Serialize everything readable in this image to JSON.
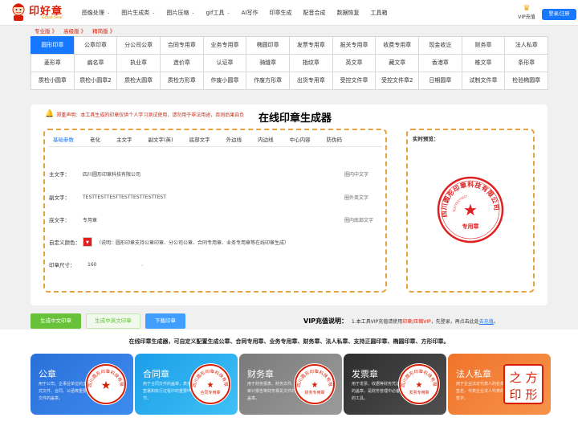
{
  "header": {
    "brand": "印好章",
    "brand_sub": "Good-Seal",
    "nav": [
      {
        "label": "图像处理",
        "dropdown": true
      },
      {
        "label": "图片生成类",
        "dropdown": true
      },
      {
        "label": "图片压缩",
        "dropdown": true
      },
      {
        "label": "gif工具",
        "dropdown": true
      },
      {
        "label": "AI写作",
        "dropdown": false
      },
      {
        "label": "印章生成",
        "dropdown": false
      },
      {
        "label": "配音合成",
        "dropdown": false
      },
      {
        "label": "数据恢复",
        "dropdown": false
      },
      {
        "label": "工具箱",
        "dropdown": false
      }
    ],
    "vip_label": "VIP充值",
    "login_label": "登录/注册"
  },
  "versions": [
    "专业版 》",
    "高级版 》",
    "精简版 》"
  ],
  "stamp_types": [
    [
      "圆形印章",
      "公章印章",
      "分公司公章",
      "合同专用章",
      "业务专用章",
      "椭圆印章",
      "发票专用章",
      "报关专用章",
      "收费专用章",
      "现金收讫",
      "财务章",
      "法人私章"
    ],
    [
      "菱形章",
      "扁名章",
      "执业章",
      "造价章",
      "认证章",
      "骑缝章",
      "指纹章",
      "英文章",
      "藏文章",
      "香港章",
      "椎文章",
      "条形章"
    ],
    [
      "质检小圆章",
      "质检小圆章2",
      "质检大圆章",
      "质检方形章",
      "作废小圆章",
      "作废方形章",
      "出货专用章",
      "受控文件章",
      "受控文件章2",
      "日期圆章",
      "试制文件章",
      "检验椭圆章"
    ]
  ],
  "active_stamp": "圆形印章",
  "notice": "郑重声明：本工具生成的印章仅供个人学习测试使用，请勿用于非法用途，否则后果自负",
  "page_title": "在线印章生成器",
  "tabs": [
    "基础参数",
    "老化",
    "主文字",
    "副文字(英)",
    "底部文字",
    "外边线",
    "内边线",
    "中心内容",
    "防伪码"
  ],
  "active_tab": "基础参数",
  "fields": {
    "main_text": {
      "label": "主文字：",
      "value": "四川圆形印章科技有限公司",
      "hint": "圈内中文字"
    },
    "sub_text": {
      "label": "副文字：",
      "value": "TESTTESTTESTTESTTESTTESTTEST",
      "hint": "圈外英文字"
    },
    "bottom_text": {
      "label": "底文字：",
      "value": "专用章",
      "hint": "圈内底部文字"
    },
    "color": {
      "label": "自定义颜色：",
      "value": "#e02020",
      "desc": "（说明：圆形印章支持公章印章、分公司公章、合同专用章、业务专用章等在线印章生成）"
    },
    "size": {
      "label": "印章尺寸：",
      "value": "160"
    }
  },
  "preview": {
    "title": "实时预览：",
    "stamp_main": "四川圆形印章科技有限公司",
    "stamp_sub": "TESTTESTTEST",
    "stamp_bottom": "专用章",
    "stamp_color": "#e02020"
  },
  "buttons": {
    "gen_cn": "生成中文印章",
    "gen_cn_en": "生成中英文印章",
    "download": "下载印章"
  },
  "vip_info": {
    "label": "VIP充值说明：",
    "text1": "1.本工具VIP充值请使用",
    "highlight": "印章/压缩VIP",
    "text2": "，先登录，再点击此处",
    "link": "去充值",
    "end": "。"
  },
  "tagline": "在线印章生成器，可自定义配置生成公章、合同专用章、业务专用章、财务章、法人私章、支持正圆印章、椭圆印章、方形印章。",
  "cards": [
    {
      "title": "公章",
      "desc": "用于公司、企事业单位的正式文件、合同、公函等重要文件的盖章。",
      "from": "#2a6fd8",
      "to": "#3d8cf0",
      "stamp_text": "四川圆形印章科技有限公司",
      "stamp_center": "★"
    },
    {
      "title": "合同章",
      "desc": "用于合同文件的盖章，表示签署和执行过程中的重要环节。",
      "from": "#1b9ee8",
      "to": "#3fc0f5",
      "stamp_text": "四川圆形印章科技有限公司",
      "stamp_center": "合同专用章"
    },
    {
      "title": "财务章",
      "desc": "用于财务报表、财务文件、审计报告等财务相关文件的盖章。",
      "from": "#7a7a7a",
      "to": "#9b9b9b",
      "stamp_text": "四川圆形印章科技有限公司",
      "stamp_center": "财务专用章"
    },
    {
      "title": "发票章",
      "desc": "用于发票、收据等财务凭证的盖章，是财务管理中必备的工具。",
      "from": "#2d2d2d",
      "to": "#505050",
      "stamp_text": "四川圆形印章科技有限公司",
      "stamp_center": "发票专用章"
    },
    {
      "title": "法人私章",
      "desc": "用于企业法定代表人的名章签名，代表企业法人代表的签字。",
      "from": "#f0732a",
      "to": "#f7934b",
      "stamp_text": "方之形印",
      "stamp_center": ""
    }
  ]
}
